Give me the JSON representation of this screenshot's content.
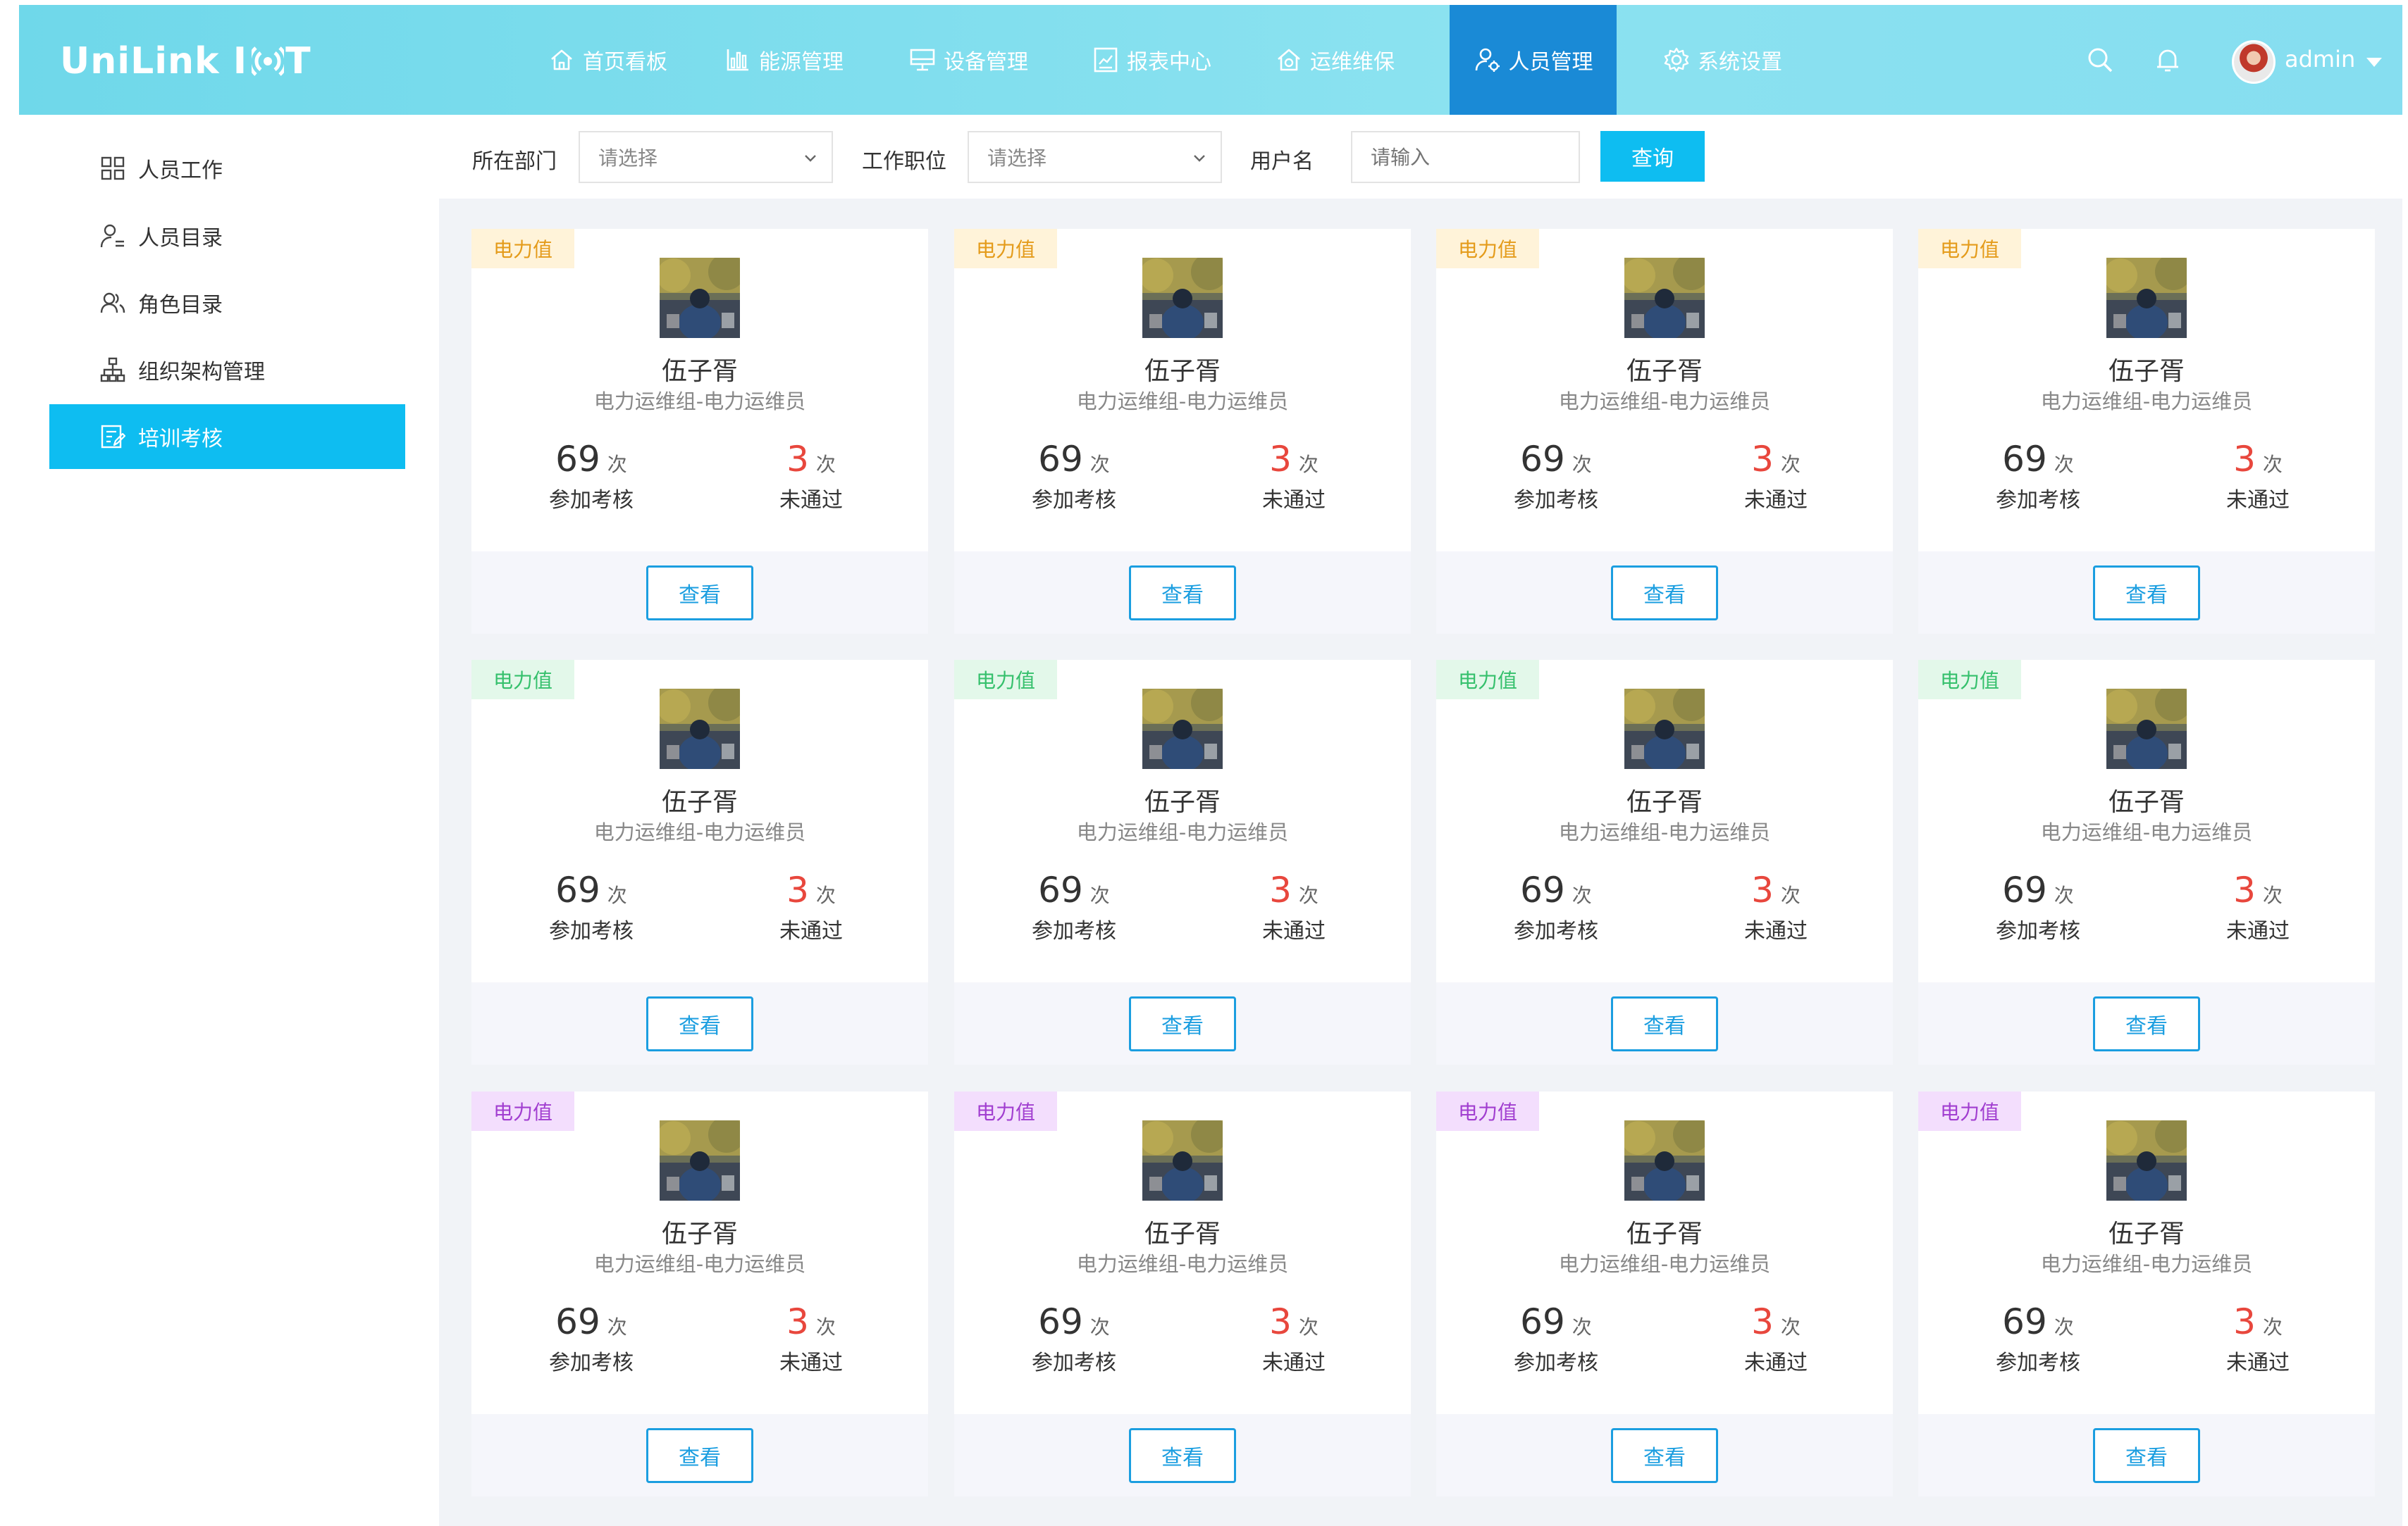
{
  "brand": {
    "logo_prefix": "UniLink I",
    "logo_suffix": "T"
  },
  "nav": [
    {
      "label": "首页看板",
      "icon": "home-icon",
      "active": false
    },
    {
      "label": "能源管理",
      "icon": "bar-chart-icon",
      "active": false
    },
    {
      "label": "设备管理",
      "icon": "monitor-icon",
      "active": false
    },
    {
      "label": "报表中心",
      "icon": "report-icon",
      "active": false
    },
    {
      "label": "运维维保",
      "icon": "house-gear-icon",
      "active": false
    },
    {
      "label": "人员管理",
      "icon": "user-gear-icon",
      "active": true
    },
    {
      "label": "系统设置",
      "icon": "gear-icon",
      "active": false
    }
  ],
  "header_right": {
    "user": "admin"
  },
  "sidebar": [
    {
      "label": "人员工作",
      "icon": "grid-icon",
      "active": false
    },
    {
      "label": "人员目录",
      "icon": "user-list-icon",
      "active": false
    },
    {
      "label": "角色目录",
      "icon": "users-icon",
      "active": false
    },
    {
      "label": "组织架构管理",
      "icon": "org-chart-icon",
      "active": false
    },
    {
      "label": "培训考核",
      "icon": "exam-icon",
      "active": true
    }
  ],
  "filters": {
    "department": {
      "label": "所在部门",
      "placeholder": "请选择"
    },
    "position": {
      "label": "工作职位",
      "placeholder": "请选择"
    },
    "username": {
      "label": "用户名",
      "placeholder": "请输入"
    },
    "query_button": "查询"
  },
  "cards": [
    {
      "tag": "电力值",
      "tag_style": "yellow",
      "name": "伍子胥",
      "dept": "电力运维组-电力运维员",
      "attend": "69",
      "attend_unit": "次",
      "attend_label": "参加考核",
      "fail": "3",
      "fail_unit": "次",
      "fail_label": "未通过",
      "button": "查看"
    },
    {
      "tag": "电力值",
      "tag_style": "yellow",
      "name": "伍子胥",
      "dept": "电力运维组-电力运维员",
      "attend": "69",
      "attend_unit": "次",
      "attend_label": "参加考核",
      "fail": "3",
      "fail_unit": "次",
      "fail_label": "未通过",
      "button": "查看"
    },
    {
      "tag": "电力值",
      "tag_style": "yellow",
      "name": "伍子胥",
      "dept": "电力运维组-电力运维员",
      "attend": "69",
      "attend_unit": "次",
      "attend_label": "参加考核",
      "fail": "3",
      "fail_unit": "次",
      "fail_label": "未通过",
      "button": "查看"
    },
    {
      "tag": "电力值",
      "tag_style": "yellow",
      "name": "伍子胥",
      "dept": "电力运维组-电力运维员",
      "attend": "69",
      "attend_unit": "次",
      "attend_label": "参加考核",
      "fail": "3",
      "fail_unit": "次",
      "fail_label": "未通过",
      "button": "查看"
    },
    {
      "tag": "电力值",
      "tag_style": "green",
      "name": "伍子胥",
      "dept": "电力运维组-电力运维员",
      "attend": "69",
      "attend_unit": "次",
      "attend_label": "参加考核",
      "fail": "3",
      "fail_unit": "次",
      "fail_label": "未通过",
      "button": "查看"
    },
    {
      "tag": "电力值",
      "tag_style": "green",
      "name": "伍子胥",
      "dept": "电力运维组-电力运维员",
      "attend": "69",
      "attend_unit": "次",
      "attend_label": "参加考核",
      "fail": "3",
      "fail_unit": "次",
      "fail_label": "未通过",
      "button": "查看"
    },
    {
      "tag": "电力值",
      "tag_style": "green",
      "name": "伍子胥",
      "dept": "电力运维组-电力运维员",
      "attend": "69",
      "attend_unit": "次",
      "attend_label": "参加考核",
      "fail": "3",
      "fail_unit": "次",
      "fail_label": "未通过",
      "button": "查看"
    },
    {
      "tag": "电力值",
      "tag_style": "green",
      "name": "伍子胥",
      "dept": "电力运维组-电力运维员",
      "attend": "69",
      "attend_unit": "次",
      "attend_label": "参加考核",
      "fail": "3",
      "fail_unit": "次",
      "fail_label": "未通过",
      "button": "查看"
    },
    {
      "tag": "电力值",
      "tag_style": "purple",
      "name": "伍子胥",
      "dept": "电力运维组-电力运维员",
      "attend": "69",
      "attend_unit": "次",
      "attend_label": "参加考核",
      "fail": "3",
      "fail_unit": "次",
      "fail_label": "未通过",
      "button": "查看"
    },
    {
      "tag": "电力值",
      "tag_style": "purple",
      "name": "伍子胥",
      "dept": "电力运维组-电力运维员",
      "attend": "69",
      "attend_unit": "次",
      "attend_label": "参加考核",
      "fail": "3",
      "fail_unit": "次",
      "fail_label": "未通过",
      "button": "查看"
    },
    {
      "tag": "电力值",
      "tag_style": "purple",
      "name": "伍子胥",
      "dept": "电力运维组-电力运维员",
      "attend": "69",
      "attend_unit": "次",
      "attend_label": "参加考核",
      "fail": "3",
      "fail_unit": "次",
      "fail_label": "未通过",
      "button": "查看"
    },
    {
      "tag": "电力值",
      "tag_style": "purple",
      "name": "伍子胥",
      "dept": "电力运维组-电力运维员",
      "attend": "69",
      "attend_unit": "次",
      "attend_label": "参加考核",
      "fail": "3",
      "fail_unit": "次",
      "fail_label": "未通过",
      "button": "查看"
    }
  ],
  "colors": {
    "header": "#7ddcee",
    "accent": "#0ebdf1",
    "nav_active": "#1a8ad6",
    "fail_number": "#e8473d",
    "button_border": "#1b9ee0"
  }
}
